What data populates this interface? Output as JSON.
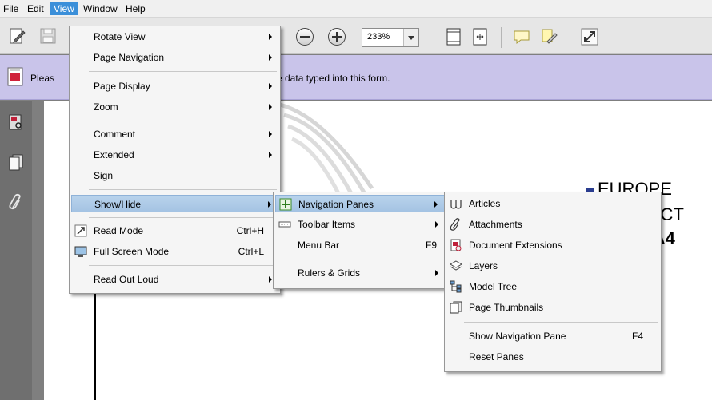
{
  "menubar": {
    "items": [
      "File",
      "Edit",
      "View",
      "Window",
      "Help"
    ]
  },
  "toolbar": {
    "zoom_value": "233%"
  },
  "message_bar": {
    "text_left": "Pleas",
    "text_right": "e data typed into this form."
  },
  "document": {
    "line1": "EUROPE",
    "line2": "RECT",
    "line3": "it A4"
  },
  "view_menu": {
    "items": [
      {
        "label": "Rotate View",
        "has_submenu": true
      },
      {
        "label": "Page Navigation",
        "has_submenu": true
      },
      {
        "label": "Page Display",
        "has_submenu": true
      },
      {
        "label": "Zoom",
        "has_submenu": true
      },
      {
        "label": "Comment",
        "has_submenu": true
      },
      {
        "label": "Extended",
        "has_submenu": true
      },
      {
        "label": "Sign"
      },
      {
        "label": "Show/Hide",
        "has_submenu": true,
        "highlighted": true
      },
      {
        "label": "Read Mode",
        "shortcut": "Ctrl+H"
      },
      {
        "label": "Full Screen Mode",
        "shortcut": "Ctrl+L"
      },
      {
        "label": "Read Out Loud",
        "has_submenu": true
      }
    ]
  },
  "showhide_menu": {
    "items": [
      {
        "label": "Navigation Panes",
        "has_submenu": true,
        "highlighted": true
      },
      {
        "label": "Toolbar Items",
        "has_submenu": true
      },
      {
        "label": "Menu Bar",
        "shortcut": "F9"
      },
      {
        "label": "Rulers & Grids",
        "has_submenu": true
      }
    ]
  },
  "navpanes_menu": {
    "items": [
      {
        "label": "Articles"
      },
      {
        "label": "Attachments"
      },
      {
        "label": "Document Extensions"
      },
      {
        "label": "Layers"
      },
      {
        "label": "Model Tree"
      },
      {
        "label": "Page Thumbnails"
      },
      {
        "label": "Show Navigation Pane",
        "shortcut": "F4"
      },
      {
        "label": "Reset Panes"
      }
    ]
  },
  "colors": {
    "menu_highlight": "#a4c3e3",
    "message_bar": "#c9c4ea",
    "menubar_active": "#3b8fd9"
  }
}
